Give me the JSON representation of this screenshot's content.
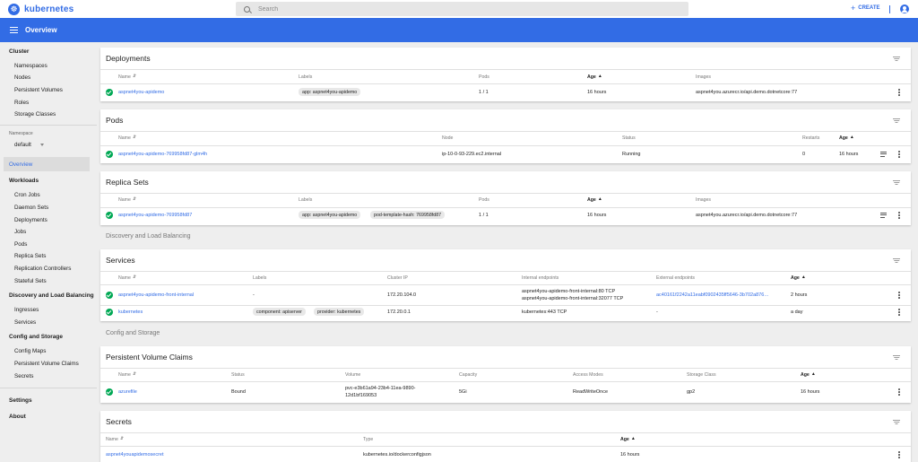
{
  "app": {
    "name": "kubernetes"
  },
  "search": {
    "placeholder": "Search"
  },
  "header": {
    "create_label": "CREATE",
    "page_title": "Overview"
  },
  "sidebar": {
    "cluster_label": "Cluster",
    "cluster_items": [
      "Namespaces",
      "Nodes",
      "Persistent Volumes",
      "Roles",
      "Storage Classes"
    ],
    "namespace_label": "Namespace",
    "namespace_value": "default",
    "overview": "Overview",
    "workloads_label": "Workloads",
    "workloads_items": [
      "Cron Jobs",
      "Daemon Sets",
      "Deployments",
      "Jobs",
      "Pods",
      "Replica Sets",
      "Replication Controllers",
      "Stateful Sets"
    ],
    "discovery_label": "Discovery and Load Balancing",
    "discovery_items": [
      "Ingresses",
      "Services"
    ],
    "config_label": "Config and Storage",
    "config_items": [
      "Config Maps",
      "Persistent Volume Claims",
      "Secrets"
    ],
    "settings": "Settings",
    "about": "About"
  },
  "deployments": {
    "title": "Deployments",
    "headers": {
      "name": "Name",
      "labels": "Labels",
      "pods": "Pods",
      "age": "Age",
      "images": "Images"
    },
    "rows": [
      {
        "name": "aspnet4you-apidemo",
        "label": "app: aspnet4you-apidemo",
        "pods": "1 / 1",
        "age": "16 hours",
        "images": "aspnet4you.azurecr.io/api.demo.dotnetcore:77"
      }
    ]
  },
  "pods": {
    "title": "Pods",
    "headers": {
      "name": "Name",
      "node": "Node",
      "status": "Status",
      "restarts": "Restarts",
      "age": "Age"
    },
    "rows": [
      {
        "name": "aspnet4you-apidemo-769958fd87-glm4h",
        "node": "ip-10-0-93-229.ec2.internal",
        "status": "Running",
        "restarts": "0",
        "age": "16 hours"
      }
    ]
  },
  "replica_sets": {
    "title": "Replica Sets",
    "headers": {
      "name": "Name",
      "labels": "Labels",
      "pods": "Pods",
      "age": "Age",
      "images": "Images"
    },
    "rows": [
      {
        "name": "aspnet4you-apidemo-769958fd87",
        "label1": "app: aspnet4you-apidemo",
        "label2": "pod-template-hash: 769958fd87",
        "pods": "1 / 1",
        "age": "16 hours",
        "images": "aspnet4you.azurecr.io/api.demo.dotnetcore:77"
      }
    ]
  },
  "section_discovery": "Discovery and Load Balancing",
  "services": {
    "title": "Services",
    "headers": {
      "name": "Name",
      "labels": "Labels",
      "cluster_ip": "Cluster IP",
      "internal": "Internal endpoints",
      "external": "External endpoints",
      "age": "Age"
    },
    "rows": [
      {
        "name": "aspnet4you-apidemo-front-internal",
        "labels": "-",
        "cluster_ip": "172.20.104.0",
        "internal1": "aspnet4you-apidemo-front-internal:80 TCP",
        "internal2": "aspnet4you-apidemo-front-internal:32077 TCP",
        "external": "ac40161f2242a11eabf0902435ff5646-3b702a876…",
        "age": "2 hours"
      },
      {
        "name": "kubernetes",
        "label1": "component: apiserver",
        "label2": "provider: kubernetes",
        "cluster_ip": "172.20.0.1",
        "internal1": "kubernetes:443 TCP",
        "external": "-",
        "age": "a day"
      }
    ]
  },
  "section_config": "Config and Storage",
  "pvc": {
    "title": "Persistent Volume Claims",
    "headers": {
      "name": "Name",
      "status": "Status",
      "volume": "Volume",
      "capacity": "Capacity",
      "access": "Access Modes",
      "storage_class": "Storage Class",
      "age": "Age"
    },
    "rows": [
      {
        "name": "azurefile",
        "status": "Bound",
        "volume1": "pvc-e3b61a94-23b4-11ea-9890-",
        "volume2": "12d1bf169053",
        "capacity": "5Gi",
        "access": "ReadWriteOnce",
        "storage_class": "gp2",
        "age": "16 hours"
      }
    ]
  },
  "secrets": {
    "title": "Secrets",
    "headers": {
      "name": "Name",
      "type": "Type",
      "age": "Age"
    },
    "rows": [
      {
        "name": "aspnet4youapidemosecret",
        "type": "kubernetes.io/dockerconfigjson",
        "age": "16 hours"
      }
    ]
  },
  "colors": {
    "brand": "#326ce5",
    "success": "#00a854"
  }
}
